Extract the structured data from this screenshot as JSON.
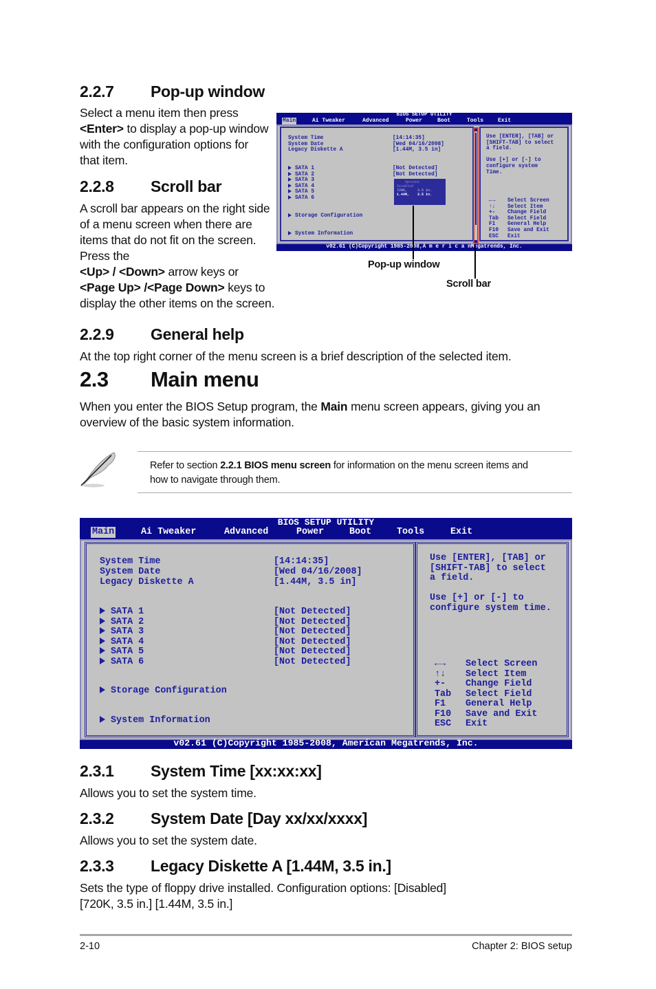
{
  "sections": {
    "s227": {
      "num": "2.2.7",
      "title": "Pop-up window",
      "body": [
        {
          "t": "Select a menu item then press"
        },
        {
          "b": "<Enter>",
          "t": " to display a pop-up window"
        },
        {
          "t": "with the configuration options for"
        },
        {
          "t": "that item."
        }
      ]
    },
    "s228": {
      "num": "2.2.8",
      "title": "Scroll bar",
      "body": [
        {
          "t": "A scroll bar appears on the right side"
        },
        {
          "t": "of a menu screen when there are"
        },
        {
          "t": "items that do not fit on the screen."
        },
        {
          "t": "Press the"
        },
        {
          "b": "<Up> / <Down>",
          "t": " arrow keys or"
        },
        {
          "b": "<Page Up> /<Page Down>",
          "t": " keys to"
        },
        {
          "t": "display the other items on the screen."
        }
      ]
    },
    "s229": {
      "num": "2.2.9",
      "title": "General help",
      "body": "At the top right corner of the menu screen is a brief description of the selected item."
    },
    "s23": {
      "num": "2.3",
      "title": "Main menu",
      "body_pre": "When you enter the BIOS Setup program, the ",
      "body_bold": "Main",
      "body_post": " menu screen appears, giving you an",
      "body_line2": "overview of the basic system information."
    },
    "s231": {
      "num": "2.3.1",
      "title": "System Time [xx:xx:xx]",
      "body": "Allows you to set the system time."
    },
    "s232": {
      "num": "2.3.2",
      "title": "System Date [Day xx/xx/xxxx]",
      "body": "Allows you to set the system date."
    },
    "s233": {
      "num": "2.3.3",
      "title": "Legacy Diskette A [1.44M, 3.5 in.]",
      "body_line1": "Sets the type of floppy drive installed. Configuration options: [Disabled]",
      "body_line2": "[720K, 3.5 in.] [1.44M, 3.5 in.]"
    }
  },
  "note": {
    "icon": "feather-pen-icon",
    "pre": "Refer to section ",
    "bold": "2.2.1 BIOS menu screen",
    "post": " for information on the menu screen items and",
    "line2": "how to navigate through them."
  },
  "captions": {
    "popup": "Pop-up window",
    "scrollbar": "Scroll bar"
  },
  "bios": {
    "title": "BIOS SETUP UTILITY",
    "menu": [
      "Main",
      "Ai Tweaker",
      "Advanced",
      "Power",
      "Boot",
      "Tools",
      "Exit"
    ],
    "active_menu": "Main",
    "fields": [
      {
        "label": "System Time",
        "value": "[14:14:35]"
      },
      {
        "label": "System Date",
        "value": "[Wed 04/16/2008]"
      },
      {
        "label": "Legacy Diskette A",
        "value": "[1.44M, 3.5 in]"
      }
    ],
    "sata": [
      {
        "label": "SATA 1",
        "value": "[Not Detected]"
      },
      {
        "label": "SATA 2",
        "value": "[Not Detected]"
      },
      {
        "label": "SATA 3",
        "value": "[Not Detected]"
      },
      {
        "label": "SATA 4",
        "value": "[Not Detected]"
      },
      {
        "label": "SATA 5",
        "value": "[Not Detected]"
      },
      {
        "label": "SATA 6",
        "value": "[Not Detected]"
      }
    ],
    "submenus": [
      "Storage Configuration",
      "System Information"
    ],
    "help_main": [
      "Use [ENTER], [TAB] or",
      "[SHIFT-TAB] to select",
      "a field.",
      "",
      "Use [+] or [-] to",
      "configure system time."
    ],
    "help_small": [
      "Use [ENTER], [TAB] or",
      "[SHIFT-TAB] to select",
      "a field.",
      "",
      "Use [+] or [-] to",
      "configure system",
      "Time."
    ],
    "keys": [
      {
        "key": "←→",
        "icon": "left-right-arrows-icon",
        "desc": "Select Screen"
      },
      {
        "key": "↑↓",
        "icon": "up-down-arrows-icon",
        "desc": "Select Item"
      },
      {
        "key": "+-",
        "desc": "Change Field"
      },
      {
        "key": "Tab",
        "desc": "Select Field"
      },
      {
        "key": "F1",
        "desc": "General Help"
      },
      {
        "key": "F10",
        "desc": "Save and Exit"
      },
      {
        "key": "ESC",
        "desc": "Exit"
      }
    ],
    "footer": "v02.61 (C)Copyright 1985-2008, American Megatrends, Inc.",
    "footer_small": "v02.61 (C)Copyright 1985-2008,A m e r i c a nMegatrends, Inc.",
    "popup": {
      "title": "Options",
      "options": [
        "Disabled",
        "720K,     3.5 in.",
        "1.44M,    3.5 in."
      ],
      "selected": "1.44M,    3.5 in."
    },
    "colors": {
      "frame": "#0a0a8c",
      "panel": "#c3c3c3",
      "text": "#1d1d9c",
      "scrollbar_highlight": "#e53a2f"
    }
  },
  "page_footer": {
    "page_number": "2-10",
    "chapter": "Chapter 2: BIOS setup"
  }
}
